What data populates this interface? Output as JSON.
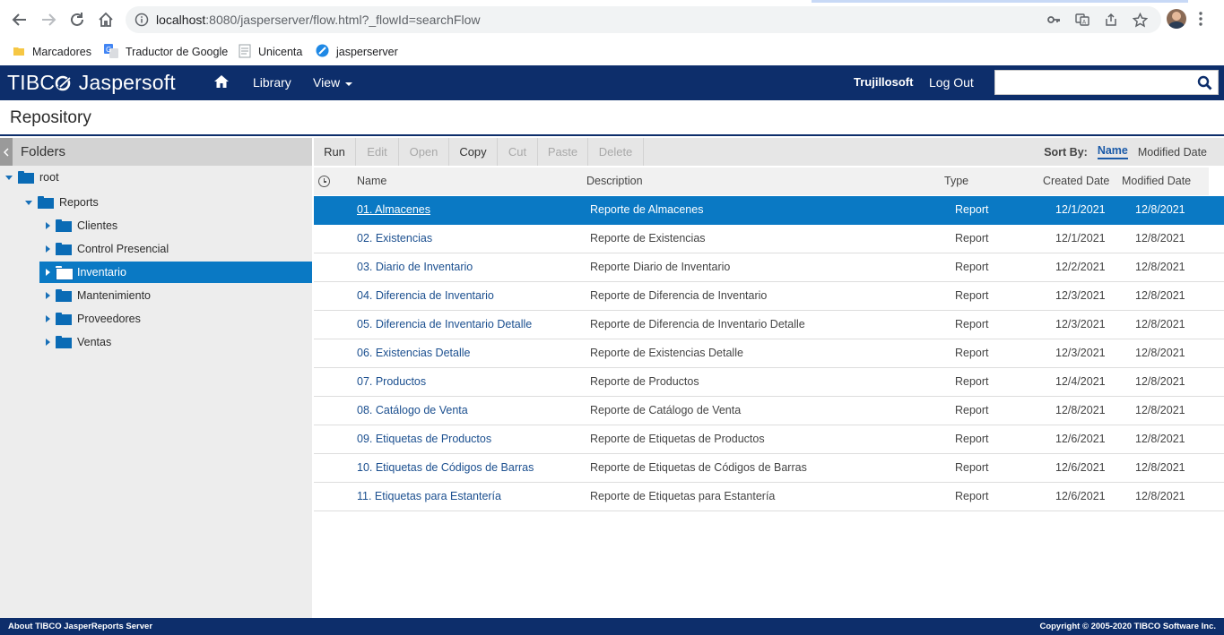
{
  "browser": {
    "url_host": "localhost",
    "url_path": ":8080/jasperserver/flow.html?_flowId=searchFlow",
    "bookmarks": [
      {
        "label": "Marcadores",
        "icon": "folder-icon"
      },
      {
        "label": "Traductor de Google",
        "icon": "google-translate-icon"
      },
      {
        "label": "Unicenta",
        "icon": "document-icon"
      },
      {
        "label": "jasperserver",
        "icon": "jaspersoft-icon"
      }
    ]
  },
  "app": {
    "logo_prefix": "TIBC",
    "logo_suffix": "Jaspersoft",
    "menu_library": "Library",
    "menu_view": "View",
    "user_name": "Trujillosoft",
    "logout_label": "Log Out",
    "search_value": "",
    "page_title": "Repository"
  },
  "folders": {
    "title": "Folders",
    "tree": [
      {
        "label": "root",
        "level": 0,
        "expanded": true
      },
      {
        "label": "Reports",
        "level": 1,
        "expanded": true
      },
      {
        "label": "Clientes",
        "level": 2,
        "expanded": false
      },
      {
        "label": "Control Presencial",
        "level": 2,
        "expanded": false
      },
      {
        "label": "Inventario",
        "level": 2,
        "expanded": false,
        "selected": true
      },
      {
        "label": "Mantenimiento",
        "level": 2,
        "expanded": false
      },
      {
        "label": "Proveedores",
        "level": 2,
        "expanded": false
      },
      {
        "label": "Ventas",
        "level": 2,
        "expanded": false
      }
    ]
  },
  "toolbar": {
    "buttons": [
      {
        "label": "Run",
        "enabled": true
      },
      {
        "label": "Edit",
        "enabled": false
      },
      {
        "label": "Open",
        "enabled": false
      },
      {
        "label": "Copy",
        "enabled": true
      },
      {
        "label": "Cut",
        "enabled": false
      },
      {
        "label": "Paste",
        "enabled": false
      },
      {
        "label": "Delete",
        "enabled": false
      }
    ],
    "sort_by_label": "Sort By:",
    "sort_name": "Name",
    "sort_modified": "Modified Date"
  },
  "table": {
    "headers": {
      "name": "Name",
      "description": "Description",
      "type": "Type",
      "created": "Created Date",
      "modified": "Modified Date"
    },
    "rows": [
      {
        "name": "01. Almacenes",
        "description": "Reporte de Almacenes",
        "type": "Report",
        "created": "12/1/2021",
        "modified": "12/8/2021",
        "selected": true
      },
      {
        "name": "02. Existencias",
        "description": "Reporte de Existencias",
        "type": "Report",
        "created": "12/1/2021",
        "modified": "12/8/2021"
      },
      {
        "name": "03. Diario de Inventario",
        "description": "Reporte Diario de Inventario",
        "type": "Report",
        "created": "12/2/2021",
        "modified": "12/8/2021"
      },
      {
        "name": "04. Diferencia de Inventario",
        "description": "Reporte de Diferencia de Inventario",
        "type": "Report",
        "created": "12/3/2021",
        "modified": "12/8/2021"
      },
      {
        "name": "05. Diferencia de Inventario Detalle",
        "description": "Reporte de Diferencia de Inventario Detalle",
        "type": "Report",
        "created": "12/3/2021",
        "modified": "12/8/2021"
      },
      {
        "name": "06. Existencias Detalle",
        "description": "Reporte de Existencias Detalle",
        "type": "Report",
        "created": "12/3/2021",
        "modified": "12/8/2021"
      },
      {
        "name": "07. Productos",
        "description": "Reporte de Productos",
        "type": "Report",
        "created": "12/4/2021",
        "modified": "12/8/2021"
      },
      {
        "name": "08. Catálogo de Venta",
        "description": "Reporte de Catálogo de Venta",
        "type": "Report",
        "created": "12/8/2021",
        "modified": "12/8/2021"
      },
      {
        "name": "09. Etiquetas de Productos",
        "description": "Reporte de Etiquetas de Productos",
        "type": "Report",
        "created": "12/6/2021",
        "modified": "12/8/2021"
      },
      {
        "name": "10. Etiquetas de Códigos de Barras",
        "description": "Reporte de Etiquetas de Códigos de Barras",
        "type": "Report",
        "created": "12/6/2021",
        "modified": "12/8/2021"
      },
      {
        "name": "11. Etiquetas para Estantería",
        "description": "Reporte de Etiquetas para Estantería",
        "type": "Report",
        "created": "12/6/2021",
        "modified": "12/8/2021"
      }
    ]
  },
  "footer": {
    "left": "About TIBCO JasperReports Server",
    "right": "Copyright © 2005-2020 TIBCO Software Inc."
  }
}
